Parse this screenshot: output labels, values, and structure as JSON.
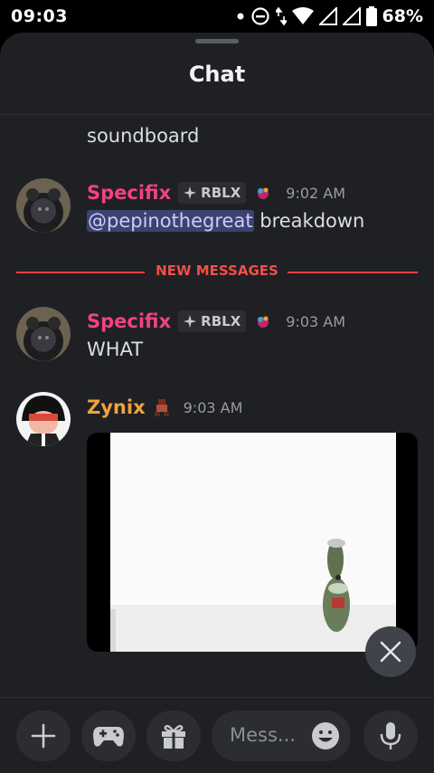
{
  "status_bar": {
    "time": "09:03",
    "battery_percent": "68%"
  },
  "header": {
    "title": "Chat"
  },
  "messages": [
    {
      "continuation_text": "soundboard"
    },
    {
      "username": "Specifix",
      "tag": "RBLX",
      "time": "9:02 AM",
      "mention": "@pepinothegreat",
      "text": " breakdown"
    },
    {
      "username": "Specifix",
      "tag": "RBLX",
      "time": "9:03 AM",
      "text": "WHAT"
    },
    {
      "username": "Zynix",
      "time": "9:03 AM",
      "attachment": "video"
    }
  ],
  "divider": {
    "label": "NEW MESSAGES"
  },
  "composer": {
    "placeholder": "Mess..."
  },
  "colors": {
    "background": "#1f2024",
    "username_specifix": "#f24186",
    "username_zynix": "#f0a23b",
    "new_messages": "#f23f43",
    "mention_bg": "#3d4270"
  }
}
